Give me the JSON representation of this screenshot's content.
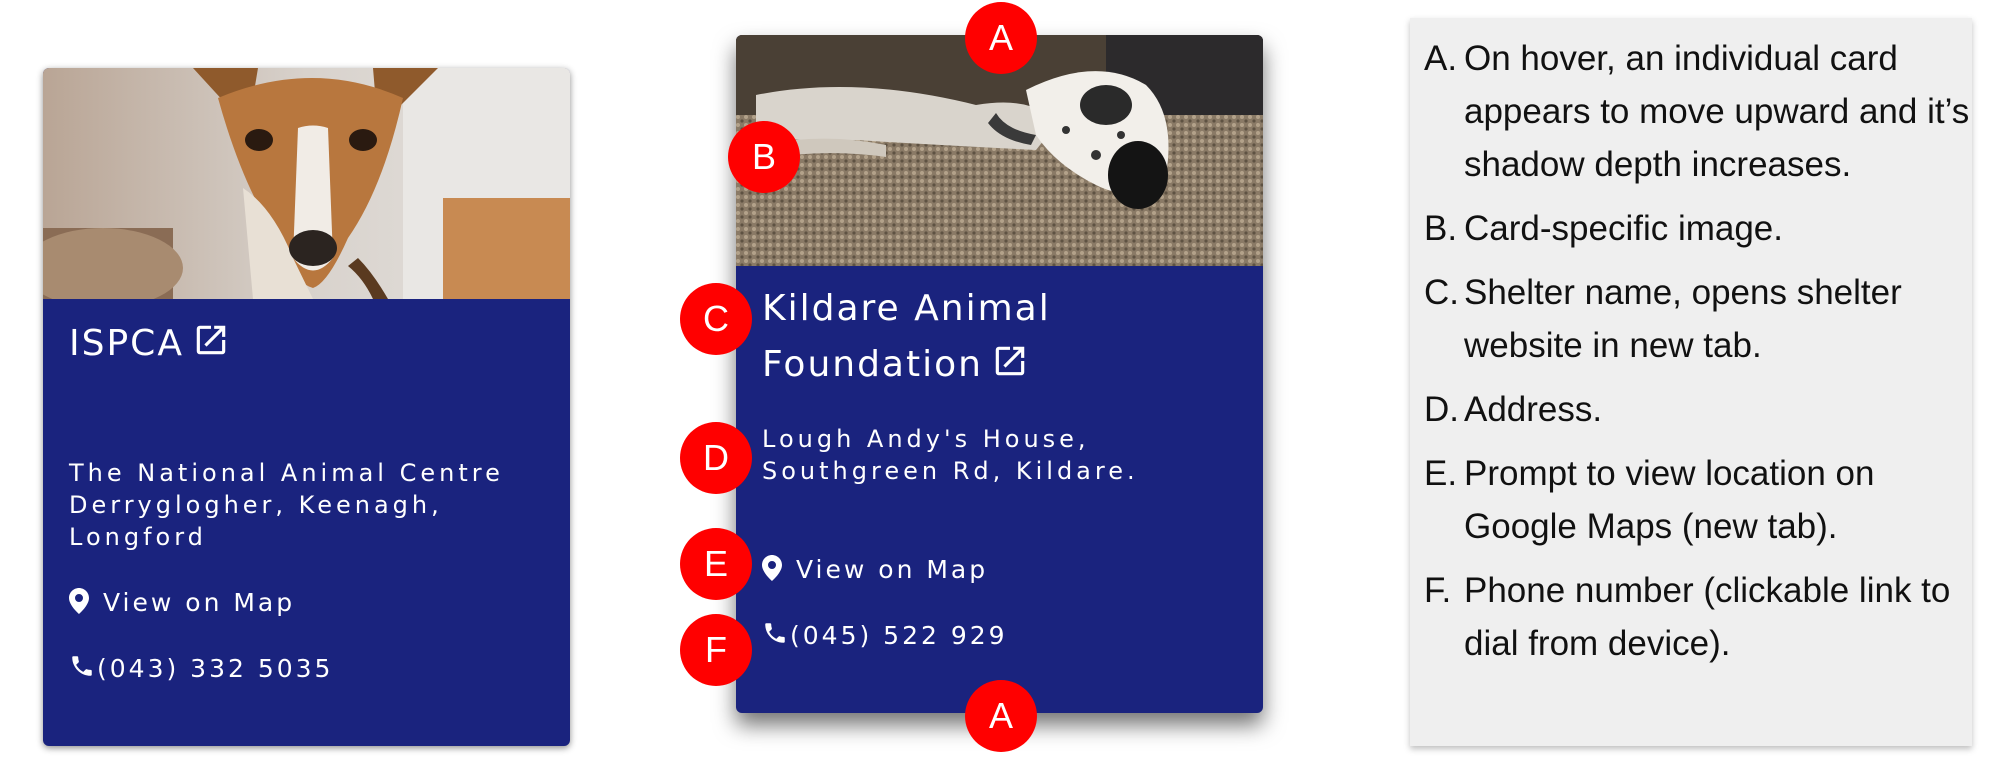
{
  "cards": [
    {
      "name": "ISPCA",
      "address": "The National Animal Centre Derryglogher, Keenagh, Longford",
      "map_label": "View on Map",
      "phone": "(043) 332 5035",
      "image": "dog-portrait-photo"
    },
    {
      "name": "Kildare Animal Foundation",
      "address": "Lough Andy's House, Southgreen Rd, Kildare.",
      "map_label": "View on Map",
      "phone": "(045) 522 929",
      "image": "greyhound-on-rug-photo"
    }
  ],
  "markers": {
    "a": "A",
    "b": "B",
    "c": "C",
    "d": "D",
    "e": "E",
    "f": "F"
  },
  "legend": [
    {
      "letter": "A.",
      "text": "On hover, an individual card appears to move upward and it’s shadow depth increases."
    },
    {
      "letter": "B.",
      "text": "Card-specific image."
    },
    {
      "letter": "C.",
      "text": "Shelter name, opens shelter website in new tab."
    },
    {
      "letter": "D.",
      "text": "Address."
    },
    {
      "letter": "E.",
      "text": "Prompt to view location on Google Maps (new tab)."
    },
    {
      "letter": "F.",
      "text": "Phone number (clickable link to dial from device)."
    }
  ],
  "colors": {
    "card_background": "#1a237e",
    "marker": "#ff0000",
    "legend_background": "#efefef",
    "text_on_card": "#ffffff"
  },
  "icons": [
    "external-link-icon",
    "map-pin-icon",
    "phone-icon"
  ]
}
